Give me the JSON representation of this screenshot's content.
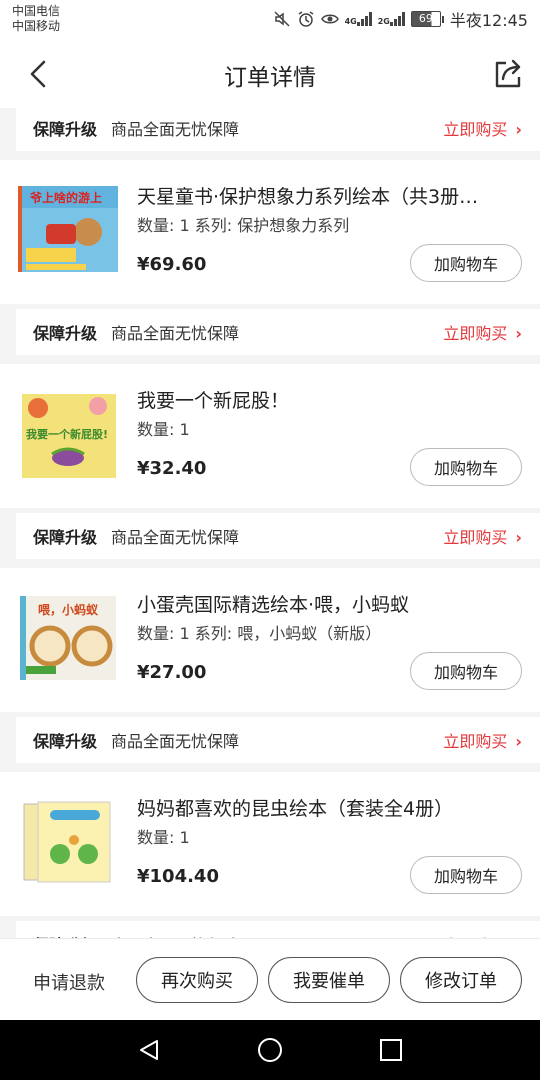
{
  "status_bar": {
    "carrier1": "中国电信",
    "carrier2": "中国移动",
    "net1": "4G",
    "net2": "2G",
    "battery": "69",
    "time": "半夜12:45"
  },
  "header": {
    "title": "订单详情",
    "back_icon": "chevron-left-icon",
    "share_icon": "share-icon"
  },
  "insurance": {
    "tag": "保障升级",
    "desc": "商品全面无忧保障",
    "buy": "立即购买",
    "chev": "›"
  },
  "products": [
    {
      "name": "天星童书·保护想象力系列绘本（共3册…",
      "meta": "数量: 1 系列: 保护想象力系列",
      "price": "¥69.60",
      "thumb_text": "爷上啥的游上"
    },
    {
      "name": "我要一个新屁股！",
      "meta": "数量: 1",
      "price": "¥32.40",
      "thumb_text": "我要一个新屁股!"
    },
    {
      "name": "小蛋壳国际精选绘本·喂，小蚂蚁",
      "meta": "数量: 1 系列: 喂，小蚂蚁（新版）",
      "price": "¥27.00",
      "thumb_text": "喂，小蚂蚁"
    },
    {
      "name": "妈妈都喜欢的昆虫绘本（套装全4册）",
      "meta": "数量: 1",
      "price": "¥104.40",
      "thumb_text": ""
    }
  ],
  "add_to_cart": "加购物车",
  "actions": {
    "refund": "申请退款",
    "rebuy": "再次购买",
    "urge": "我要催单",
    "modify": "修改订单"
  },
  "colors": {
    "accent_red": "#e4393c",
    "bg_gray": "#f4f4f4"
  }
}
